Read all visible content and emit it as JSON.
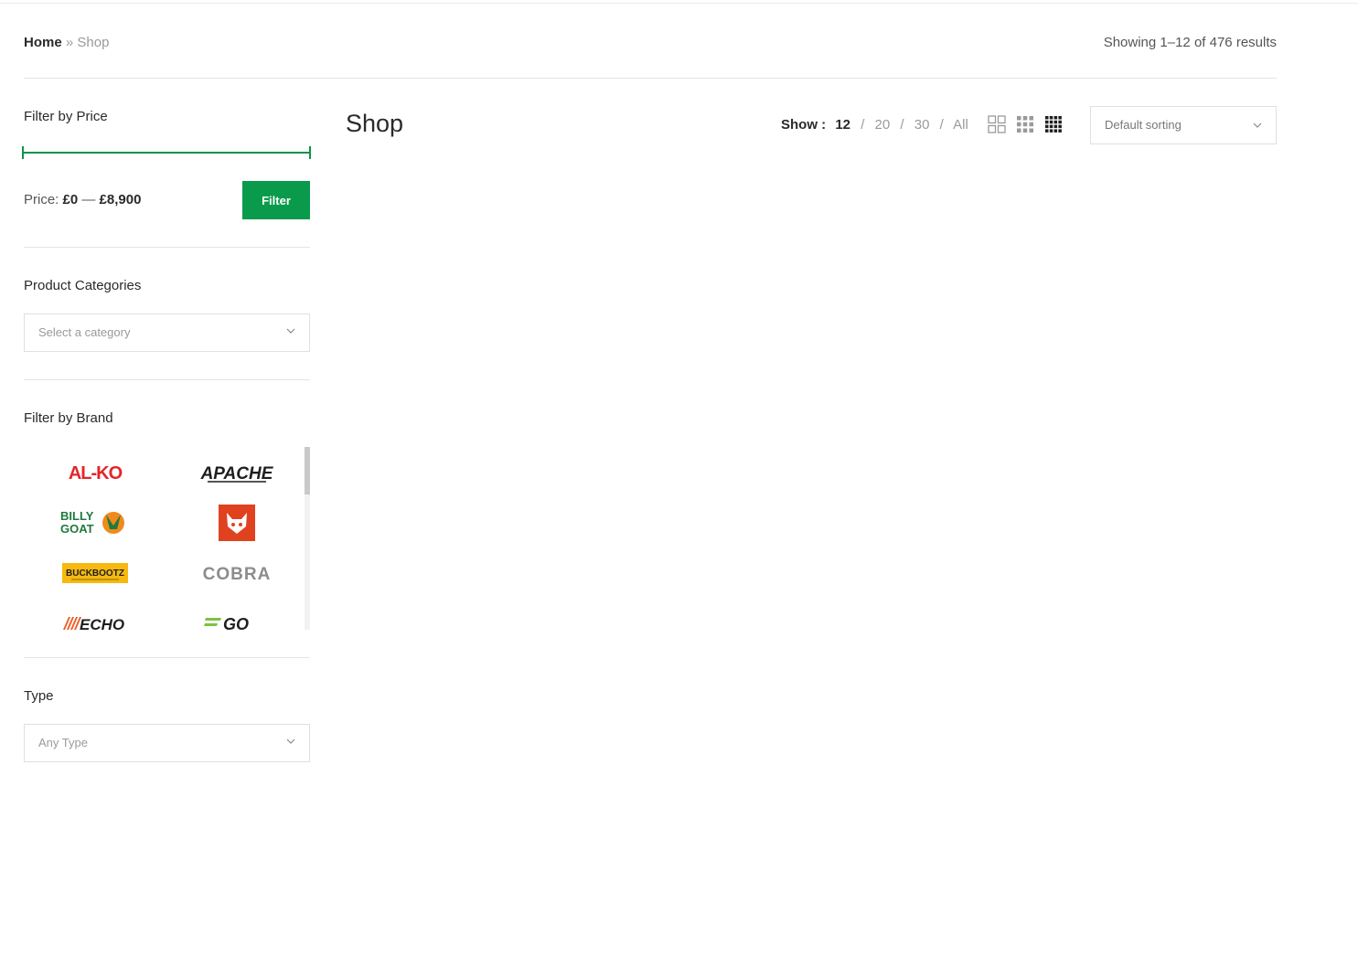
{
  "breadcrumb": {
    "home": "Home",
    "separator": "»",
    "current": "Shop"
  },
  "results_text": "Showing 1–12 of 476 results",
  "sidebar": {
    "price": {
      "title": "Filter by Price",
      "price_label": "Price:",
      "min": "£0",
      "dash": "—",
      "max": "£8,900",
      "filter_button": "Filter"
    },
    "categories": {
      "title": "Product Categories",
      "placeholder": "Select a category"
    },
    "brand": {
      "title": "Filter by Brand",
      "brands": [
        "AL-KO",
        "APACHE",
        "BILLY GOAT",
        "Bobcat",
        "BUCKBOOTZ",
        "COBRA",
        "ECHO",
        "EGO"
      ]
    },
    "type": {
      "title": "Type",
      "placeholder": "Any Type"
    }
  },
  "main": {
    "title": "Shop",
    "show_label": "Show :",
    "show_options": [
      "12",
      "20",
      "30",
      "All"
    ],
    "show_selected": "12",
    "sorting": "Default sorting"
  },
  "colors": {
    "accent": "#0a9a4b",
    "alko_red": "#e3252b",
    "bobcat_orange": "#e0421f",
    "buckbootz_yellow": "#f7b90f",
    "ego_green": "#7cc242"
  }
}
